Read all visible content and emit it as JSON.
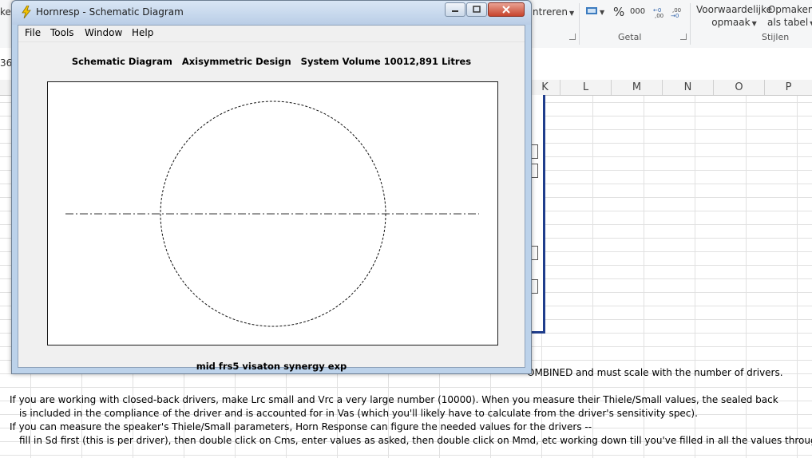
{
  "excel": {
    "ribbon": {
      "centreren_label": "ntreren",
      "percent_symbol": "%",
      "thousands_symbol": "000",
      "cond_format_line1": "Voorwaardelijke",
      "cond_format_line2": "opmaak",
      "format_table_line1": "Opmaken",
      "format_table_line2": "als tabel",
      "group_getal": "Getal",
      "group_stijlen": "Stijlen",
      "left_cut": "ke"
    },
    "name_box_cut": "36",
    "columns": [
      "K",
      "L",
      "M",
      "N",
      "O",
      "P"
    ],
    "sheet_lines": [
      "OMBINED and must scale with the number of drivers.",
      "If you are working with closed-back drivers, make Lrc small and Vrc a very large number (10000).  When you measure their Thiele/Small values, the sealed back",
      "is included in the compliance of the driver and is accounted for in Vas (which you'll likely have to calculate from the driver's sensitivity spec).",
      "If you can measure the speaker's Thiele/Small parameters, Horn Response can figure the needed values for the drivers --",
      "fill in Sd first (this is per driver), then double click on Cms, enter values as asked, then double click on Mmd, etc working down till you've filled in all the values through Le."
    ],
    "accent_color": "#1f3d8c"
  },
  "window": {
    "title": "Hornresp - Schematic Diagram",
    "menu": [
      "File",
      "Tools",
      "Window",
      "Help"
    ],
    "header": "Schematic Diagram   Axisymmetric Design   System Volume 10012,891 Litres",
    "caption": "mid frs5 visaton synergy exp",
    "close_color": "#c7442d"
  }
}
